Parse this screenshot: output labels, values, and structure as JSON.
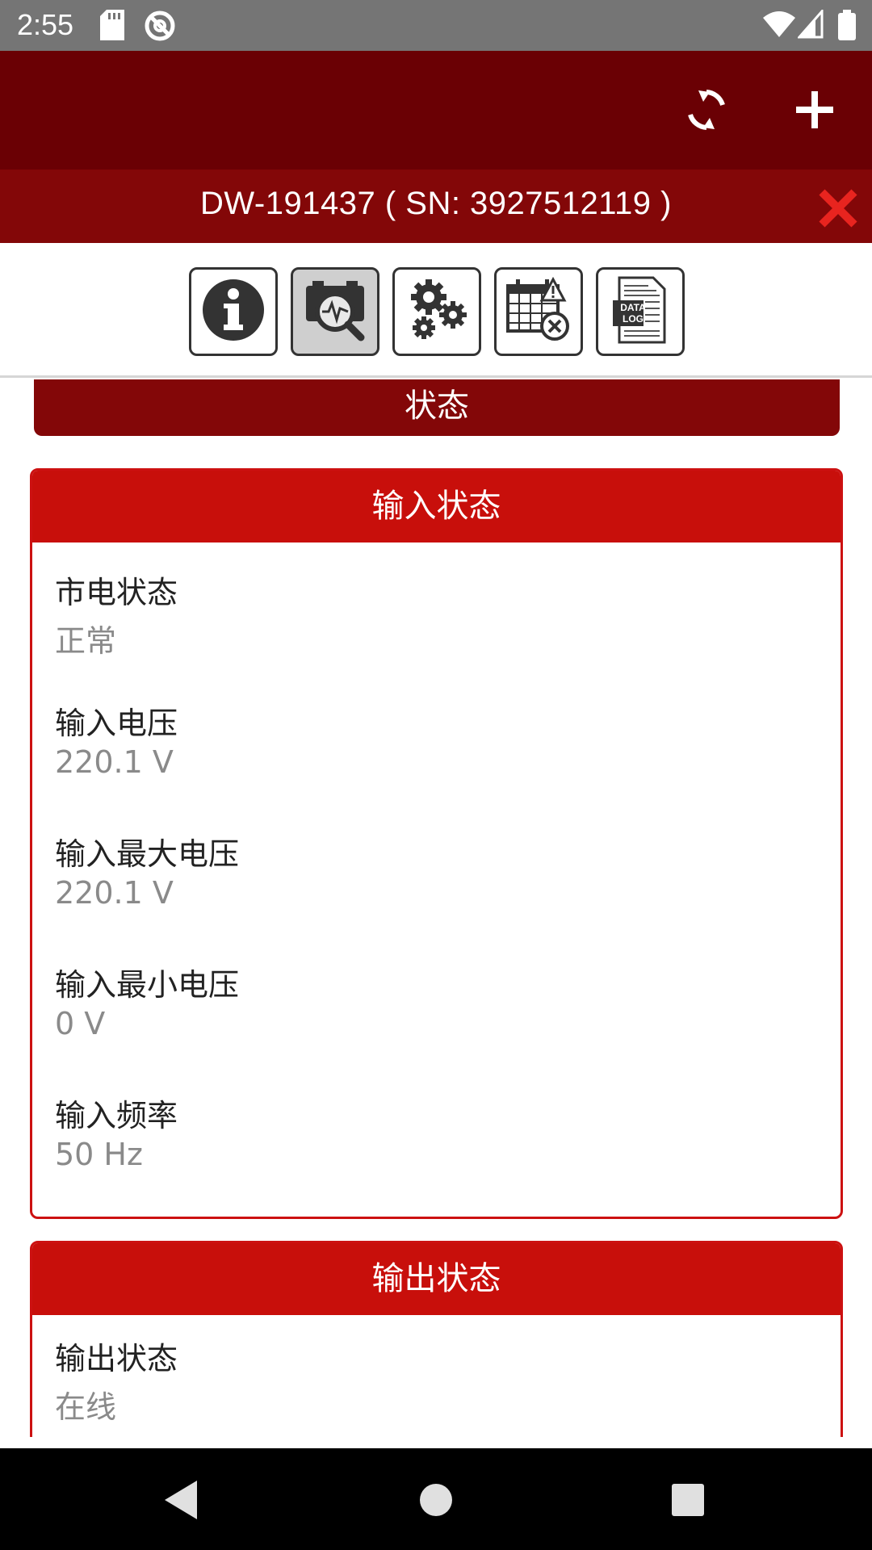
{
  "status_bar": {
    "time": "2:55",
    "icons": [
      "sd-card-icon",
      "do-not-disturb-icon",
      "wifi-icon",
      "signal-icon",
      "battery-icon"
    ]
  },
  "app_bar": {
    "actions": [
      "refresh-icon",
      "add-icon"
    ]
  },
  "device_bar": {
    "title": "DW-191437 ( SN: 3927512119 )",
    "close_icon": "close-icon",
    "close_color": "#e8241f"
  },
  "toolbar": {
    "tools": [
      {
        "icon": "info-icon",
        "active": false
      },
      {
        "icon": "battery-monitor-icon",
        "active": true
      },
      {
        "icon": "gears-icon",
        "active": false
      },
      {
        "icon": "calendar-warning-icon",
        "active": false
      },
      {
        "icon": "data-log-icon",
        "active": false,
        "text": "DATA LOG"
      }
    ]
  },
  "section": {
    "title": "状态"
  },
  "input_card": {
    "title": "输入状态",
    "items": [
      {
        "label": "市电状态",
        "value": "正常"
      },
      {
        "label": "输入电压",
        "value": "220.1 V"
      },
      {
        "label": "输入最大电压",
        "value": "220.1 V"
      },
      {
        "label": "输入最小电压",
        "value": "0 V"
      },
      {
        "label": "输入频率",
        "value": "50 Hz"
      }
    ]
  },
  "output_card": {
    "title": "输出状态",
    "items": [
      {
        "label": "输出状态",
        "value": "在线"
      }
    ]
  },
  "colors": {
    "appbar": "#6a0004",
    "devicebar": "#830708",
    "card_header": "#c80f0b",
    "card_border": "#cc1111"
  },
  "nav_bar": {
    "buttons": [
      "back-icon",
      "home-icon",
      "recents-icon"
    ]
  }
}
